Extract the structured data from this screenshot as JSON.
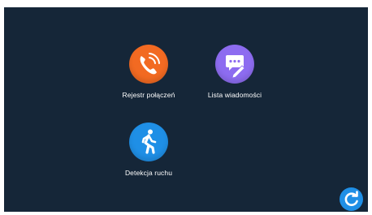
{
  "menu": {
    "items": [
      {
        "label": "Rejestr połączeń",
        "icon": "phone-icon",
        "color": "#f26a22"
      },
      {
        "label": "Lista wiadomości",
        "icon": "message-edit-icon",
        "color": "#8d6cf0"
      },
      {
        "label": "Detekcja ruchu",
        "icon": "walking-person-icon",
        "color": "#1f8fe6"
      }
    ]
  },
  "back_button": {
    "icon": "refresh-back-icon",
    "color": "#1f8fe6"
  },
  "colors": {
    "background": "#152638",
    "text": "#ffffff"
  }
}
